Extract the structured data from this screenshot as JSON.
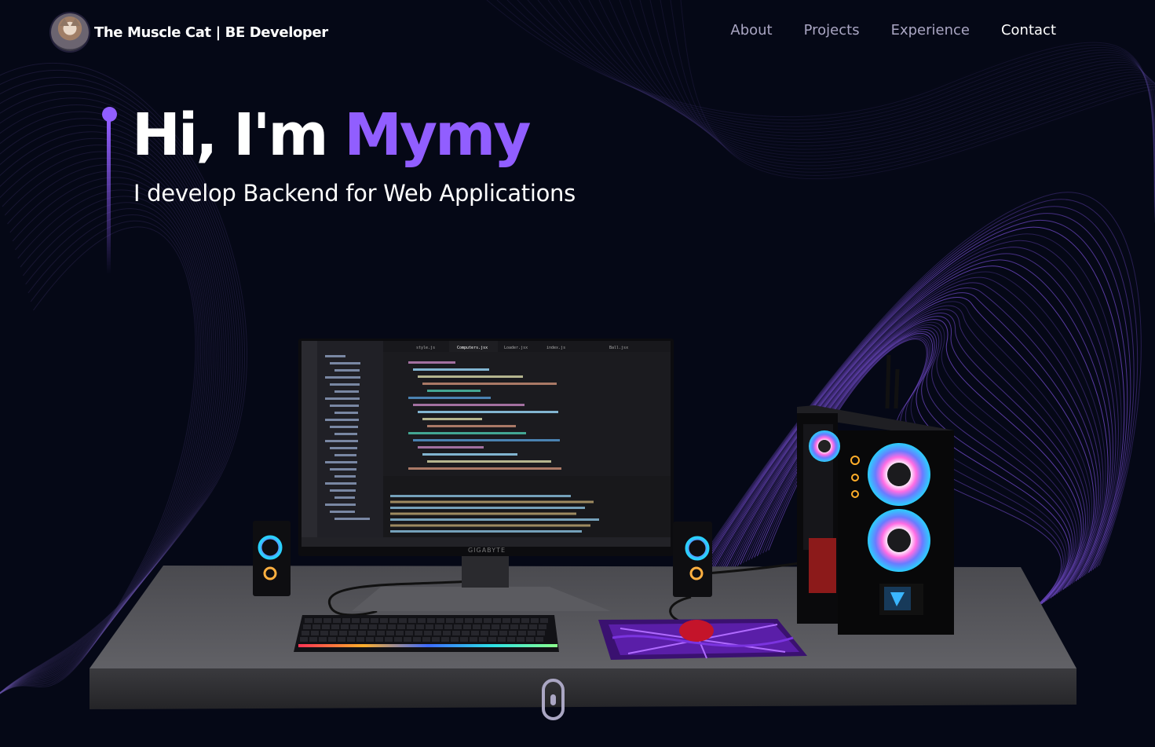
{
  "nav": {
    "brand_name": "The Muscle Cat",
    "brand_separator": "|",
    "brand_role": "BE Developer",
    "links": [
      "About",
      "Projects",
      "Experience",
      "Contact"
    ],
    "active_link": "Contact"
  },
  "hero": {
    "greeting": "Hi, I'm ",
    "name": "Mymy",
    "subtitle": "I develop Backend for Web Applications"
  },
  "editor": {
    "tabs": [
      "style.js",
      "Computers.jsx",
      "Loader.jsx",
      "index.js",
      "Ball.jsx"
    ],
    "monitor_brand": "GIGABYTE"
  },
  "colors": {
    "background": "#050816",
    "accent": "#915EFF",
    "secondary_text": "#aaa6c3"
  }
}
